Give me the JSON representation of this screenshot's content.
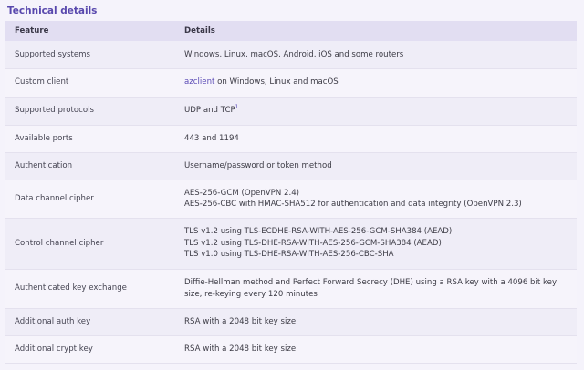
{
  "section_title": "Technical details",
  "table": {
    "headers": [
      "Feature",
      "Details"
    ],
    "rows": [
      {
        "feature": "Supported systems",
        "details": [
          "Windows, Linux, macOS, Android, iOS and some routers"
        ]
      },
      {
        "feature": "Custom client",
        "link": "azclient",
        "details_suffix": " on Windows, Linux and macOS"
      },
      {
        "feature": "Supported protocols",
        "details_text": "UDP and TCP",
        "sup": "1"
      },
      {
        "feature": "Available ports",
        "details": [
          "443 and 1194"
        ]
      },
      {
        "feature": "Authentication",
        "details": [
          "Username/password or token method"
        ]
      },
      {
        "feature": "Data channel cipher",
        "details": [
          "AES-256-GCM (OpenVPN 2.4)",
          "AES-256-CBC with HMAC-SHA512 for authentication and data integrity (OpenVPN 2.3)"
        ]
      },
      {
        "feature": "Control channel cipher",
        "details": [
          "TLS v1.2 using TLS-ECDHE-RSA-WITH-AES-256-GCM-SHA384 (AEAD)",
          "TLS v1.2 using TLS-DHE-RSA-WITH-AES-256-GCM-SHA384 (AEAD)",
          "TLS v1.0 using TLS-DHE-RSA-WITH-AES-256-CBC-SHA"
        ]
      },
      {
        "feature": "Authenticated key exchange",
        "details": [
          "Diffie-Hellman method and Perfect Forward Secrecy (DHE) using a RSA key with a 4096 bit key",
          "size, re-keying every 120 minutes"
        ]
      },
      {
        "feature": "Additional auth key",
        "details": [
          "RSA with a 2048 bit key size"
        ]
      },
      {
        "feature": "Additional crypt key",
        "details": [
          "RSA with a 2048 bit key size"
        ]
      }
    ]
  },
  "colors": {
    "accent": "#5848ad",
    "header_bg": "#e2def2",
    "row_odd": "#efedf7",
    "row_even": "#f6f4fb",
    "page_bg": "#f5f3fb"
  }
}
